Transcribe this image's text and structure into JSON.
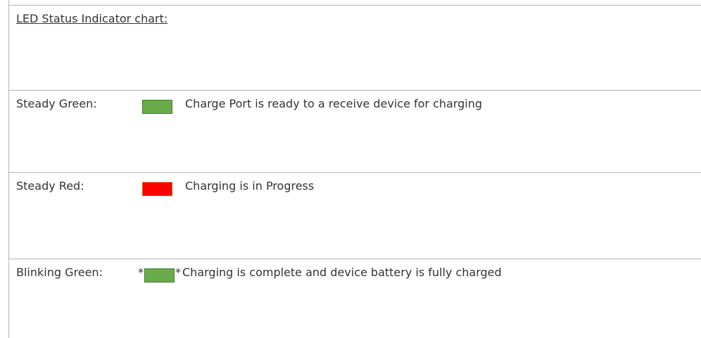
{
  "title": "LED Status Indicator chart:",
  "colors": {
    "green_fill": "#6aac4a",
    "green_border": "#3f7a2b",
    "red_fill": "#ff0000",
    "red_border": "#e05a1c",
    "rule": "#b4b4b4",
    "text": "#333333"
  },
  "rows": [
    {
      "label": "Steady Green:",
      "indicator": "green-swatch",
      "description": "Charge Port is ready to a receive device for charging"
    },
    {
      "label": "Steady Red:",
      "indicator": "red-swatch",
      "description": "Charging is in Progress"
    },
    {
      "label": "Blinking Green:",
      "indicator": "blinking-green-swatch",
      "star_before": "*",
      "star_after": "*",
      "description": "Charging is complete and device battery is fully charged"
    }
  ]
}
